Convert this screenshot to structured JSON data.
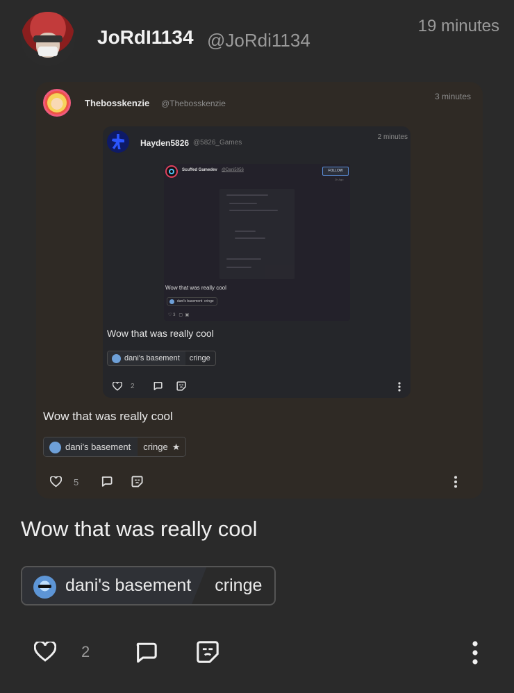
{
  "post": {
    "author_name": "JoRdI1134",
    "author_handle": "@JoRdi1134",
    "time": "19 minutes",
    "text": "Wow that was really cool",
    "community_name": "dani's basement",
    "flair": "cringe",
    "like_count": "2"
  },
  "quote1": {
    "author_name": "Thebosskenzie",
    "author_handle": "@Thebosskenzie",
    "time": "3 minutes",
    "text": "Wow that was really cool",
    "community_name": "dani's basement",
    "flair": "cringe",
    "like_count": "5"
  },
  "quote2": {
    "author_name": "Hayden5826",
    "author_handle": "@5826_Games",
    "time": "2 minutes",
    "text": "Wow that was really cool",
    "community_name": "dani's basement",
    "flair": "cringe",
    "like_count": "2"
  },
  "quote3": {
    "author_name": "Scuffed Gamedev",
    "author_handle": "@Dani5056",
    "follow_label": "FOLLOW",
    "time": "2h Ago",
    "text": "Wow that was really cool",
    "community_name": "dani's basement",
    "flair": "cringe",
    "like_count": "3"
  },
  "icons": {
    "like": "heart-icon",
    "comment": "comment-icon",
    "quote": "quote-icon",
    "more": "more-vertical-icon",
    "flair_star": "star-icon"
  },
  "colors": {
    "background": "#2a2a2a",
    "quote_card": "#2f2a25",
    "text_primary": "#f0f0f0",
    "text_secondary": "#9a9a9a"
  }
}
